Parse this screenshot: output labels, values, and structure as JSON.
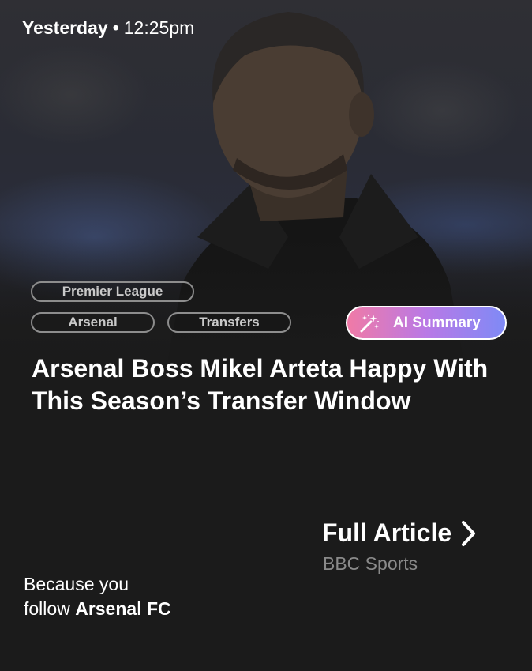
{
  "timestamp": {
    "day": "Yesterday",
    "separator": "•",
    "time": "12:25pm"
  },
  "tags": {
    "league": "Premier League",
    "team": "Arsenal",
    "topic": "Transfers"
  },
  "ai_summary": {
    "label": "AI Summary",
    "icon": "magic-wand-icon",
    "gradient": [
      "#f07aa6",
      "#b979e6",
      "#7f8af6"
    ]
  },
  "headline": "Arsenal Boss Mikel Arteta Happy With This Season’s Transfer Window",
  "article_link": {
    "label": "Full Article",
    "icon": "chevron-right-icon",
    "source": "BBC Sports"
  },
  "reason": {
    "line1": "Because you",
    "line2_prefix": "follow",
    "team": "Arsenal FC"
  },
  "colors": {
    "background": "#1b1b1b",
    "tag_border": "#8d8d8d",
    "source_text": "#8a8a8a"
  }
}
